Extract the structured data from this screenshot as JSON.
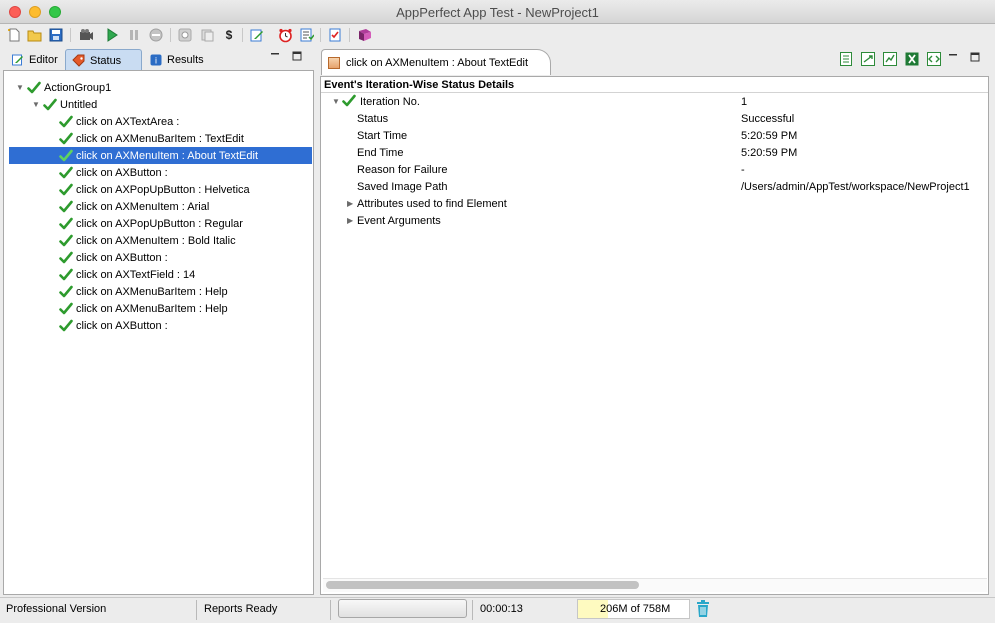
{
  "window": {
    "title": "AppPerfect App Test - NewProject1"
  },
  "toolbar": {
    "icons": [
      "new-file-icon",
      "open-folder-icon",
      "save-icon",
      "record-icon",
      "play-icon",
      "pause-icon",
      "stop-icon",
      "settings-icon",
      "script-icon",
      "dollar-icon",
      "edit-icon",
      "alarm-clock-icon",
      "checklist-icon",
      "checkbox-doc-icon",
      "book-icon"
    ]
  },
  "left_tabs": [
    {
      "label": "Editor",
      "active": false
    },
    {
      "label": "Status",
      "active": true
    },
    {
      "label": "Results",
      "active": false
    }
  ],
  "tree": [
    {
      "label": "ActionGroup1",
      "level": 0,
      "expanded": true,
      "selected": false
    },
    {
      "label": "Untitled",
      "level": 1,
      "expanded": true,
      "selected": false
    },
    {
      "label": "click on AXTextArea :",
      "level": 2,
      "selected": false
    },
    {
      "label": "click on AXMenuBarItem : TextEdit",
      "level": 2,
      "selected": false
    },
    {
      "label": "click on AXMenuItem : About TextEdit",
      "level": 2,
      "selected": true
    },
    {
      "label": "click on AXButton :",
      "level": 2,
      "selected": false
    },
    {
      "label": "click on AXPopUpButton : Helvetica",
      "level": 2,
      "selected": false
    },
    {
      "label": "click on AXMenuItem : Arial",
      "level": 2,
      "selected": false
    },
    {
      "label": "click on AXPopUpButton : Regular",
      "level": 2,
      "selected": false
    },
    {
      "label": "click on AXMenuItem : Bold Italic",
      "level": 2,
      "selected": false
    },
    {
      "label": "click on AXButton :",
      "level": 2,
      "selected": false
    },
    {
      "label": "click on AXTextField : 14",
      "level": 2,
      "selected": false
    },
    {
      "label": "click on AXMenuBarItem : Help",
      "level": 2,
      "selected": false
    },
    {
      "label": "click on AXMenuBarItem : Help",
      "level": 2,
      "selected": false
    },
    {
      "label": "click on AXButton :",
      "level": 2,
      "selected": false
    }
  ],
  "right_tab": {
    "label": "click on AXMenuItem : About TextEdit"
  },
  "right_toolbar": {
    "icons": [
      "export-html-icon",
      "export-pdf-icon",
      "export-chart-icon",
      "export-excel-icon",
      "export-xml-icon"
    ]
  },
  "details": {
    "heading": "Event's Iteration-Wise Status Details",
    "iteration_label": "Iteration No.",
    "iteration_value": "1",
    "rows": [
      {
        "label": "Status",
        "value": "Successful"
      },
      {
        "label": "Start Time",
        "value": "5:20:59 PM"
      },
      {
        "label": "End Time",
        "value": "5:20:59 PM"
      },
      {
        "label": "Reason for Failure",
        "value": "-"
      },
      {
        "label": "Saved Image Path",
        "value": "/Users/admin/AppTest/workspace/NewProject1"
      }
    ],
    "collapsed": [
      "Attributes used to find Element",
      "Event Arguments"
    ]
  },
  "status_bar": {
    "edition": "Professional Version",
    "reports": "Reports Ready",
    "elapsed": "00:00:13",
    "memory": "206M of 758M",
    "memory_used_fraction": 0.27
  },
  "colors": {
    "selection": "#2f6ed3",
    "check_green": "#2e9b2e",
    "memory_fill": "#fefac0"
  }
}
